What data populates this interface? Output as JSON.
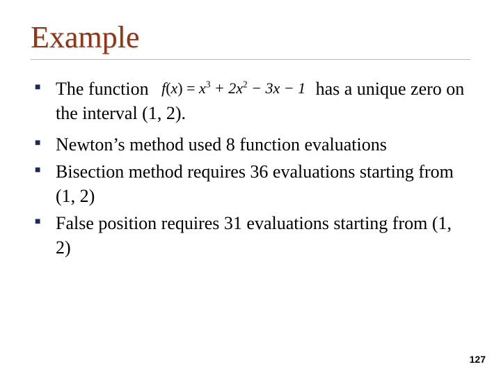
{
  "title": "Example",
  "formula": {
    "fname": "f",
    "var": "x",
    "rhs_html": "x³ + 2x² − 3x − 1"
  },
  "bullets1": {
    "item1_pre": "The function",
    "item1_post": "has a unique zero on the interval (1, 2)."
  },
  "bullets2": {
    "item1": "Newton’s method used 8 function evaluations",
    "item2": "Bisection method requires 36 evaluations starting from (1, 2)",
    "item3": "False position requires 31 evaluations starting from (1, 2)"
  },
  "page_number": "127"
}
